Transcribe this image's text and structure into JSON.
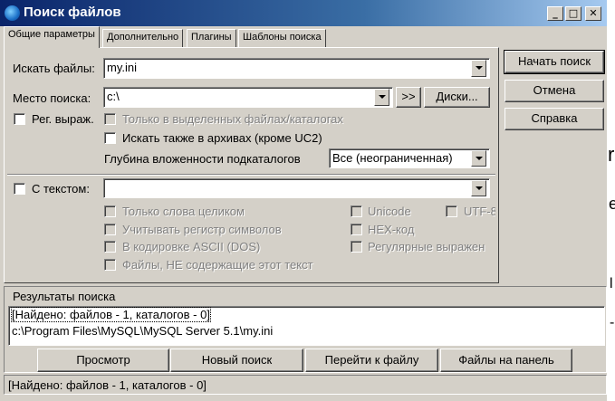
{
  "window": {
    "title": "Поиск файлов"
  },
  "titlebar_buttons": {
    "minimize": "_",
    "maximize": "□",
    "close": "✕"
  },
  "tabs": [
    {
      "label": "Общие параметры",
      "active": true
    },
    {
      "label": "Дополнительно",
      "active": false
    },
    {
      "label": "Плагины",
      "active": false
    },
    {
      "label": "Шаблоны поиска",
      "active": false
    }
  ],
  "search": {
    "files_label": "Искать файлы:",
    "files_value": "my.ini",
    "location_label": "Место поиска:",
    "location_value": "c:\\",
    "arrows_label": ">>",
    "disks_label": "Диски...",
    "regex_label": "Рег. выраж.",
    "only_selected_label": "Только в выделенных файлах/каталогах",
    "archives_label": "Искать также в архивах (кроме UC2)",
    "depth_label": "Глубина вложенности подкаталогов",
    "depth_value": "Все (неограниченная)"
  },
  "text_search": {
    "with_text_label": "С текстом:",
    "text_value": "",
    "whole_words": "Только слова целиком",
    "case_sensitive": "Учитывать регистр символов",
    "ascii_dos": "В кодировке ASCII (DOS)",
    "not_containing": "Файлы, НЕ содержащие этот текст",
    "unicode": "Unicode",
    "hex": "HEX-код",
    "regex": "Регулярные выражен",
    "utf8": "UTF-8"
  },
  "side_buttons": {
    "start": "Начать поиск",
    "cancel": "Отмена",
    "help": "Справка"
  },
  "results": {
    "title": "Результаты поиска",
    "lines": [
      "[Найдено: файлов - 1, каталогов - 0]",
      "c:\\Program Files\\MySQL\\MySQL Server 5.1\\my.ini"
    ]
  },
  "bottom_buttons": {
    "view": "Просмотр",
    "new_search": "Новый поиск",
    "goto_file": "Перейти к файлу",
    "to_panel": "Файлы на панель"
  },
  "status": "[Найдено: файлов - 1, каталогов - 0]",
  "background_fragments": [
    "r",
    "e",
    "l",
    "-"
  ]
}
